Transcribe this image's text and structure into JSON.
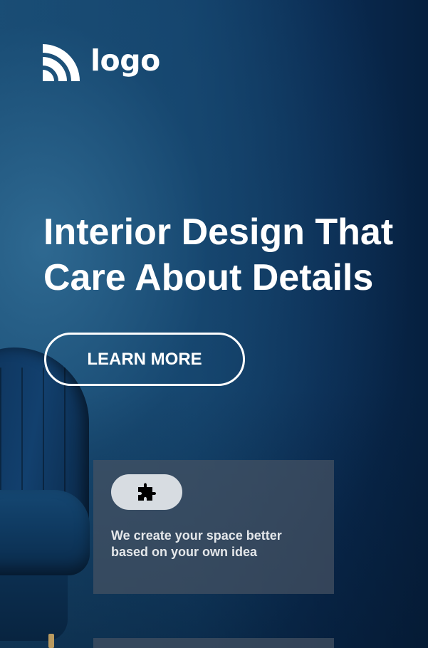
{
  "logo": {
    "text": "logo",
    "icon": "logo-arcs-icon"
  },
  "hero": {
    "headline_line1": "Interior Design That",
    "headline_line2": "Care About Details",
    "cta_label": "LEARN MORE"
  },
  "feature_card": {
    "icon": "puzzle-piece-icon",
    "description": "We create your space better based on your own idea"
  },
  "colors": {
    "background": "#0b2a4a",
    "text": "#ffffff",
    "card_background": "#455262",
    "pill_background": "#d7dce1",
    "accent_chair": "#12406e"
  }
}
